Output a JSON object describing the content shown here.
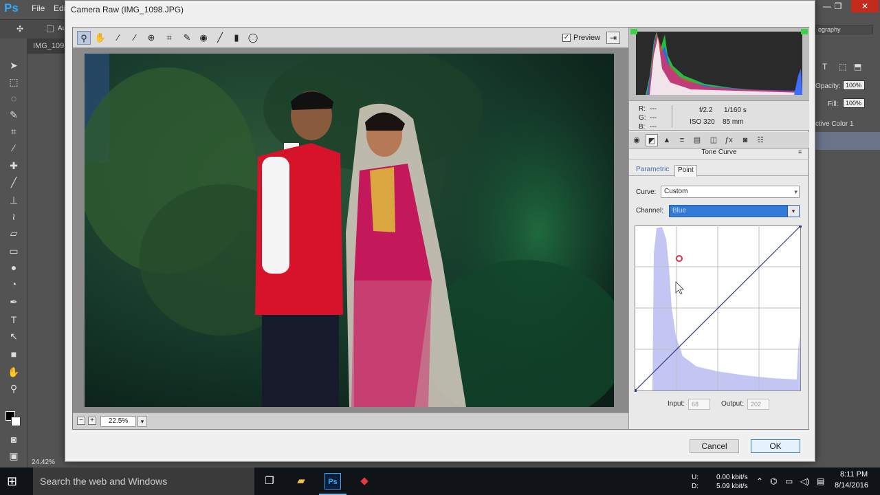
{
  "photoshop": {
    "menus": [
      "File",
      "Edi"
    ],
    "tab_title": "IMG_109",
    "status_zoom": "24.42%",
    "workspace": "ography",
    "opacity_label": "Opacity:",
    "opacity_value": "100%",
    "fill_label": "Fill:",
    "fill_value": "100%",
    "layer_label": "ctive Color 1",
    "options_text": "Au"
  },
  "dialog": {
    "title": "Camera Raw (IMG_1098.JPG)",
    "toolbar": {
      "tools": [
        "zoom-icon",
        "hand-icon",
        "white-balance-icon",
        "color-sampler-icon",
        "targeted-adjustment-icon",
        "crop-icon",
        "straighten-icon",
        "spot-removal-icon",
        "red-eye-icon",
        "adjustment-brush-icon",
        "graduated-filter-icon",
        "radial-filter-icon"
      ],
      "preview_label": "Preview",
      "preview_checked": true
    },
    "zoom": {
      "value": "22.5%",
      "minus": "−",
      "plus": "+"
    },
    "readout": {
      "r_label": "R:",
      "g_label": "G:",
      "b_label": "B:",
      "r_value": "---",
      "g_value": "---",
      "b_value": "---",
      "aperture": "f/2.2",
      "shutter": "1/160 s",
      "iso": "ISO 320",
      "focal": "85 mm"
    },
    "panel": {
      "title": "Tone Curve",
      "subtabs": [
        "Parametric",
        "Point"
      ],
      "active_subtab": "Point",
      "curve_label": "Curve:",
      "curve_value": "Custom",
      "channel_label": "Channel:",
      "channel_value": "Blue",
      "input_label": "Input:",
      "input_value": "68",
      "output_label": "Output:",
      "output_value": "202"
    },
    "buttons": {
      "cancel": "Cancel",
      "ok": "OK"
    }
  },
  "taskbar": {
    "search_placeholder": "Search the web and Windows",
    "net_up_label": "U:",
    "net_down_label": "D:",
    "net_up_value": "0.00 kbit/s",
    "net_down_value": "5.09 kbit/s",
    "time": "8:11 PM",
    "date": "8/14/2016"
  },
  "colors": {
    "ps_background": "#535353",
    "dialog_background": "#f0f0f0",
    "accent_blue": "#3379d6",
    "curve_point": "#d0334a",
    "taskbar": "#101418"
  }
}
